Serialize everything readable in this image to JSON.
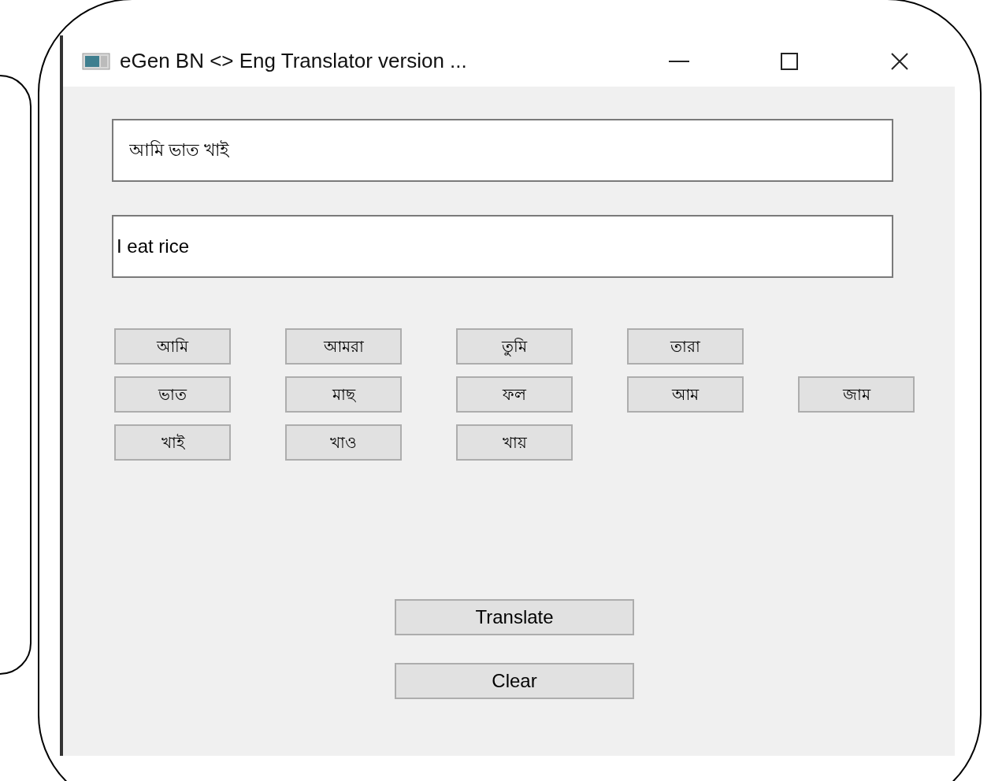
{
  "window": {
    "title": "eGen BN <> Eng Translator version ..."
  },
  "source_field": {
    "value": "আমি ভাত খাই"
  },
  "result_field": {
    "value": "I eat rice"
  },
  "word_buttons": [
    [
      "আমি",
      "আমরা",
      "তুমি",
      "তারা"
    ],
    [
      "ভাত",
      "মাছ",
      "ফল",
      "আম",
      "জাম"
    ],
    [
      "খাই",
      "খাও",
      "খায়"
    ]
  ],
  "actions": [
    "Translate",
    "Clear"
  ]
}
